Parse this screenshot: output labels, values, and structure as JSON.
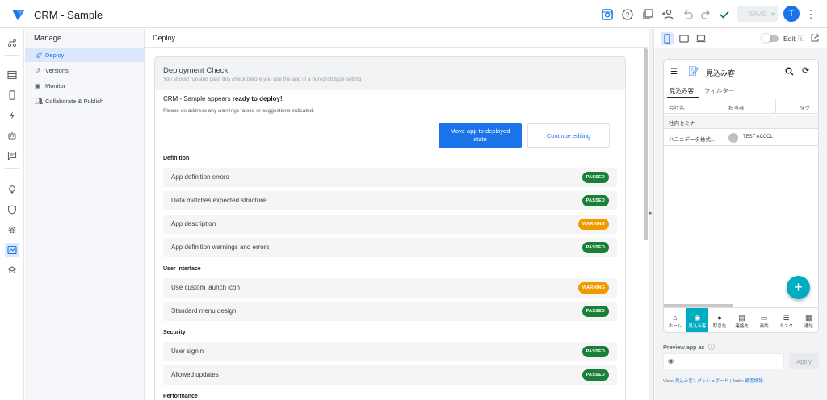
{
  "app": {
    "title": "CRM - Sample",
    "save_label": "SAVE",
    "avatar_letter": "T"
  },
  "manage": {
    "title": "Manage",
    "items": [
      {
        "label": "Deploy",
        "icon": "rocket-icon",
        "active": true
      },
      {
        "label": "Versions",
        "icon": "history-icon",
        "active": false
      },
      {
        "label": "Monitor",
        "icon": "monitor-icon",
        "active": false
      },
      {
        "label": "Collaborate & Publish",
        "icon": "people-icon",
        "active": false
      }
    ]
  },
  "deploy": {
    "title": "Deploy",
    "check_title": "Deployment Check",
    "check_subtitle": "You should run and pass this check before you use the app in a non-prototype setting",
    "ready_prefix": "CRM - Sample appears ",
    "ready_bold": "ready to deploy!",
    "warning_note": "Please do address any warnings raised or suggestions indicated.",
    "move_button": "Move app to deployed state",
    "continue_button": "Continue editing",
    "sections": [
      {
        "title": "Definition",
        "rows": [
          {
            "label": "App definition errors",
            "status": "PASSED"
          },
          {
            "label": "Data matches expected structure",
            "status": "PASSED"
          },
          {
            "label": "App description",
            "status": "WARNING"
          },
          {
            "label": "App definition warnings and errors",
            "status": "PASSED"
          }
        ]
      },
      {
        "title": "User Interface",
        "rows": [
          {
            "label": "Use custom launch icon",
            "status": "WARNING"
          },
          {
            "label": "Standard menu design",
            "status": "PASSED"
          }
        ]
      },
      {
        "title": "Security",
        "rows": [
          {
            "label": "User signin",
            "status": "PASSED"
          },
          {
            "label": "Allowed updates",
            "status": "PASSED"
          }
        ]
      },
      {
        "title": "Performance",
        "rows": []
      }
    ]
  },
  "preview": {
    "edit_label": "Edit",
    "phone": {
      "title": "見込み客",
      "tabs": [
        "見込み客",
        "フィルター"
      ],
      "columns": [
        "会社名",
        "担当者",
        "タグ"
      ],
      "group": "社内セミナー",
      "row": {
        "company": "ハコニデータ株式...",
        "person": "TEST ACCOL"
      },
      "nav": [
        {
          "label": "ホーム",
          "icon": "home-icon",
          "active": false
        },
        {
          "label": "見込み客",
          "icon": "account-circle-icon",
          "active": true
        },
        {
          "label": "取引先",
          "icon": "person-icon",
          "active": false
        },
        {
          "label": "連絡先",
          "icon": "contacts-icon",
          "active": false
        },
        {
          "label": "商談",
          "icon": "chat-icon",
          "active": false
        },
        {
          "label": "タスク",
          "icon": "checklist-icon",
          "active": false
        },
        {
          "label": "通話",
          "icon": "phone-log-icon",
          "active": false
        }
      ]
    },
    "preview_as_label": "Preview app as",
    "apply_label": "Apply",
    "footer_view_label": "View:",
    "footer_view_link": "見込み客：ダッシュボード",
    "footer_sep": "|",
    "footer_table_label": "Table:",
    "footer_table_link": "顧客情報"
  },
  "colors": {
    "accent": "#1a73e8",
    "passed": "#188038",
    "warning": "#f29900",
    "fab": "#00acc1"
  }
}
